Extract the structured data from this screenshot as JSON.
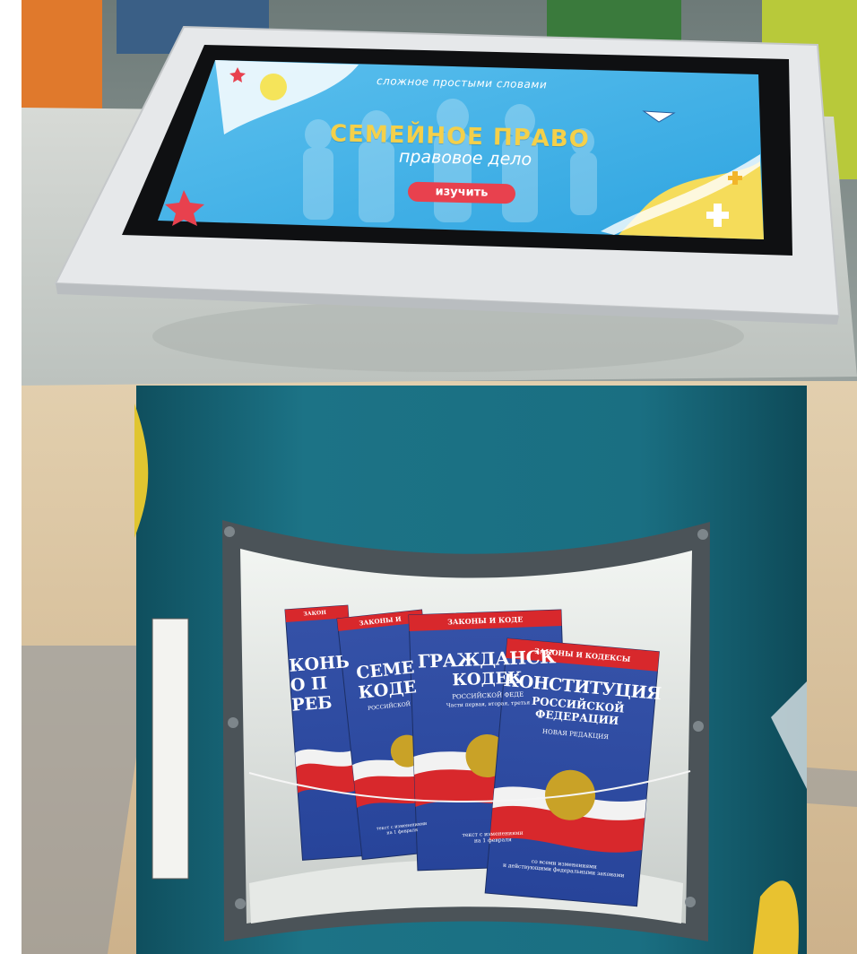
{
  "screen": {
    "tagline": "сложное простыми словами",
    "title": "СЕМЕЙНОЕ ПРАВО",
    "subtitle": "правовое дело",
    "button_label": "изучить"
  },
  "books": [
    {
      "series": "ЗАКОНЫ И КОДЕКСЫ",
      "title_lines": [
        "КОНСТИТУЦИЯ",
        "РОССИЙСКОЙ ФЕДЕРАЦИИ"
      ],
      "subtitle": "НОВАЯ РЕДАКЦИЯ",
      "footer_lines": [
        "со всеми изменениями",
        "и действующими федеральными законами"
      ]
    },
    {
      "series": "ЗАКОНЫ И КОДЕ",
      "title_lines": [
        "ГРАЖДАНСК",
        "КОДЕК"
      ],
      "subtitle": "РОССИЙСКОЙ ФЕДЕ",
      "extra": "Части первая, вторая, третья",
      "footer_lines": [
        "текст с изменениями",
        "на 1 февраля"
      ]
    },
    {
      "series": "ЗАКОНЫ И",
      "title_lines": [
        "СЕМЕ",
        "КОДЕ"
      ],
      "subtitle": "РОССИЙСКОЙ",
      "footer_lines": [
        "текст с изменениями",
        "на 1 февраля"
      ]
    },
    {
      "series": "ЗАКОН",
      "title_lines": [
        "КОНЬ",
        "О П",
        "РЕБ"
      ]
    }
  ],
  "colors": {
    "screen_blue": "#3fb1e8",
    "screen_blue_light": "#7ccdf2",
    "title_yellow": "#f4d04a",
    "button_red": "#e8414e",
    "pedestal_teal": "#1a6f82",
    "book_blue": "#2f4fa6",
    "book_red": "#d8282c",
    "bezel_gray": "#e4e6e8",
    "floor_tan": "#d9c3a1"
  },
  "icons": [
    "lightbulb-icon",
    "star-icon",
    "paper-plane-icon",
    "plus-icon",
    "russian-coat-of-arms-icon"
  ]
}
